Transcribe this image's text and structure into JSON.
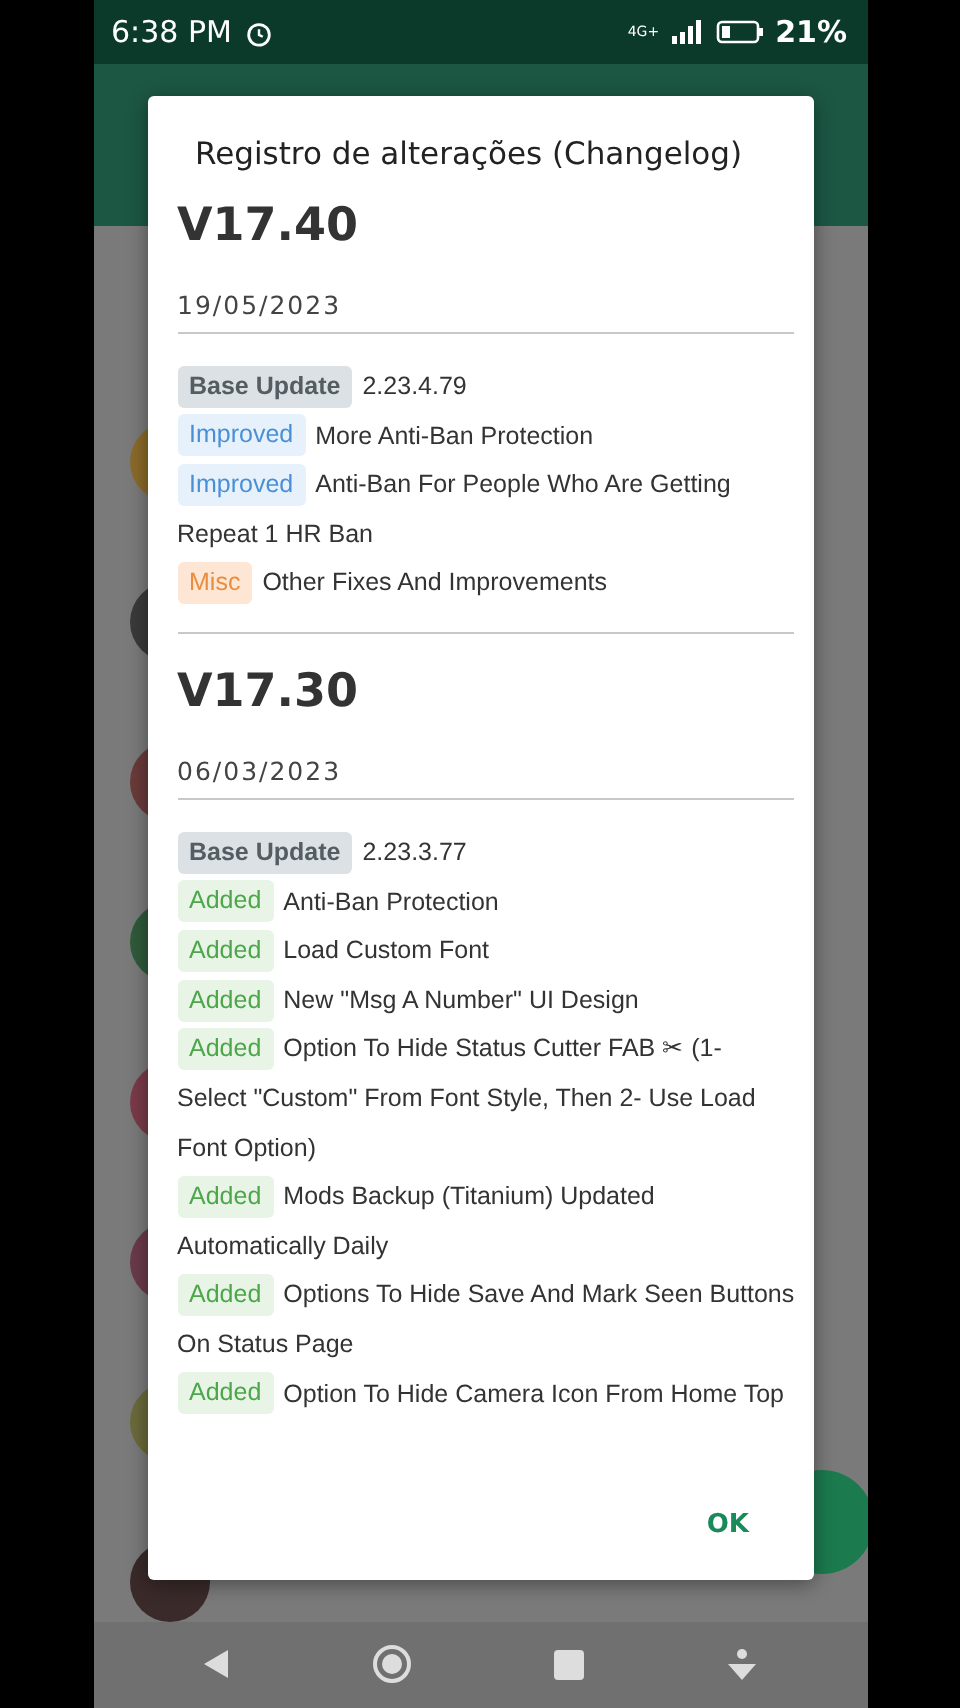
{
  "status_bar": {
    "time": "6:38 PM",
    "network": "4G+",
    "battery": "21%"
  },
  "dialog": {
    "title": "Registro de alterações (Changelog)",
    "releases": [
      {
        "version": "V17.40",
        "date": "19/05/2023",
        "changes": [
          {
            "kind": "base",
            "tag": "Base Update",
            "lines": [
              "2.23.4.79"
            ]
          },
          {
            "kind": "improved",
            "tag": "Improved",
            "lines": [
              "More Anti-Ban Protection"
            ]
          },
          {
            "kind": "improved",
            "tag": "Improved",
            "lines": [
              "Anti-Ban For People Who Are Getting",
              "Repeat 1 HR Ban"
            ]
          },
          {
            "kind": "misc",
            "tag": "Misc",
            "lines": [
              "Other Fixes And Improvements"
            ]
          }
        ]
      },
      {
        "version": "V17.30",
        "date": "06/03/2023",
        "changes": [
          {
            "kind": "base",
            "tag": "Base Update",
            "lines": [
              "2.23.3.77"
            ]
          },
          {
            "kind": "added",
            "tag": "Added",
            "lines": [
              "Anti-Ban Protection"
            ]
          },
          {
            "kind": "added",
            "tag": "Added",
            "lines": [
              "Load Custom Font"
            ]
          },
          {
            "kind": "added",
            "tag": "Added",
            "lines": [
              "New \"Msg A Number\" UI Design"
            ]
          },
          {
            "kind": "added",
            "tag": "Added",
            "lines": [
              "Option To Hide Status Cutter FAB ✂ (1-",
              "Select \"Custom\" From Font Style, Then 2- Use Load",
              "Font Option)"
            ]
          },
          {
            "kind": "added",
            "tag": "Added",
            "lines": [
              "Mods Backup (Titanium) Updated",
              "Automatically Daily"
            ]
          },
          {
            "kind": "added",
            "tag": "Added",
            "lines": [
              "Options To Hide Save And Mark Seen Buttons",
              "On Status Page"
            ]
          },
          {
            "kind": "added",
            "tag": "Added",
            "lines": [
              "Option To Hide Camera Icon From Home Top"
            ]
          }
        ]
      }
    ],
    "button": "OK"
  }
}
